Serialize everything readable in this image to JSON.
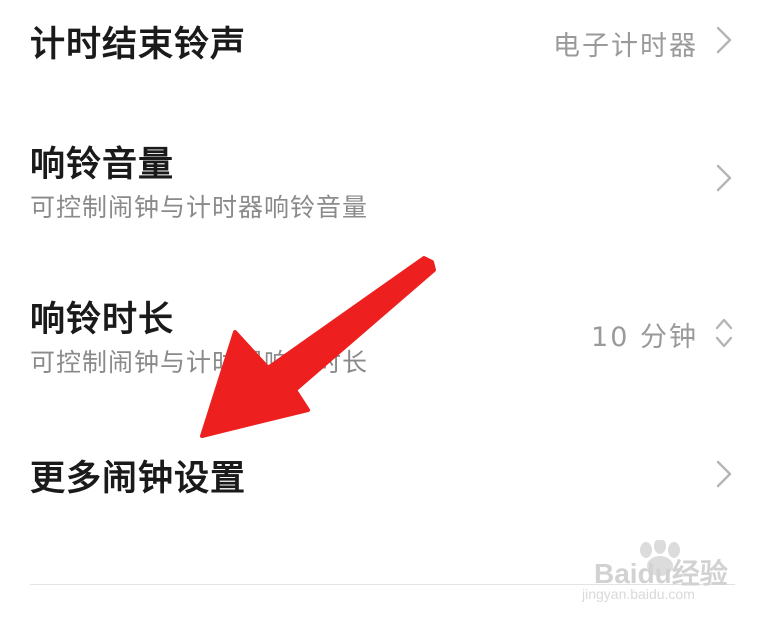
{
  "settings": {
    "timer_ringtone": {
      "title": "计时结束铃声",
      "value": "电子计时器"
    },
    "ring_volume": {
      "title": "响铃音量",
      "subtitle": "可控制闹钟与计时器响铃音量"
    },
    "ring_duration": {
      "title": "响铃时长",
      "subtitle": "可控制闹钟与计时器响铃时长",
      "value": "10 分钟"
    },
    "more_alarm_settings": {
      "title": "更多闹钟设置"
    }
  },
  "watermark": {
    "logo_text": "Baidu经验",
    "url_text": "jingyan.baidu.com"
  },
  "colors": {
    "title": "#1a1a1a",
    "subtitle": "#8a8a8a",
    "value": "#9a9a9a",
    "chevron": "#b5b5b5",
    "annotation_arrow": "#ee1f1f",
    "divider": "#e3e3e3"
  }
}
